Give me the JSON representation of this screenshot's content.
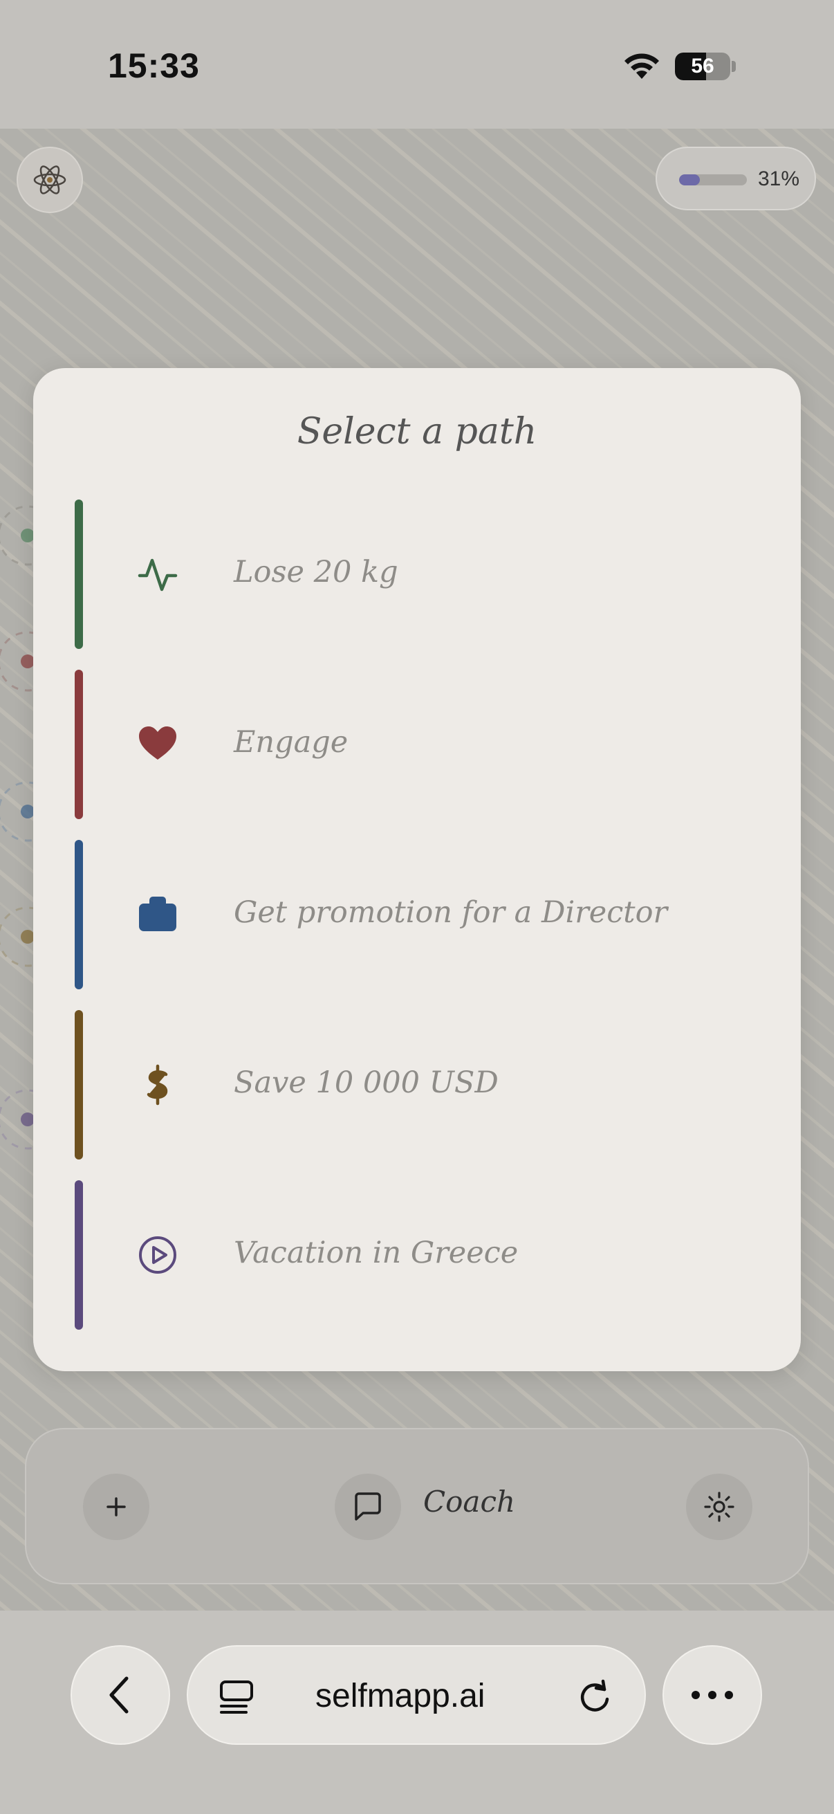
{
  "status_bar": {
    "time": "15:33",
    "battery_level": "56"
  },
  "header": {
    "progress_value": 31,
    "progress_label": "31%",
    "progress_color": "#6d6aa8"
  },
  "modal": {
    "title": "Select a path",
    "paths": [
      {
        "label": "Lose 20 kg",
        "icon": "activity-icon",
        "color": "#3d6b48"
      },
      {
        "label": "Engage",
        "icon": "heart-icon",
        "color": "#8a3b3d"
      },
      {
        "label": "Get promotion for a Director",
        "icon": "briefcase-icon",
        "color": "#2f5687"
      },
      {
        "label": "Save 10 000 USD",
        "icon": "dollar-icon",
        "color": "#6e5120"
      },
      {
        "label": "Vacation in Greece",
        "icon": "play-circle-icon",
        "color": "#5b4a7d"
      }
    ]
  },
  "toolbar": {
    "add_icon": "plus-icon",
    "coach_label": "Coach",
    "coach_icon": "chat-bubble-icon",
    "theme_icon": "sun-icon"
  },
  "browser": {
    "url": "selfmapp.ai",
    "back_icon": "chevron-left-icon",
    "tabs_icon": "tabs-icon",
    "reload_icon": "reload-icon",
    "more_icon": "more-icon"
  }
}
